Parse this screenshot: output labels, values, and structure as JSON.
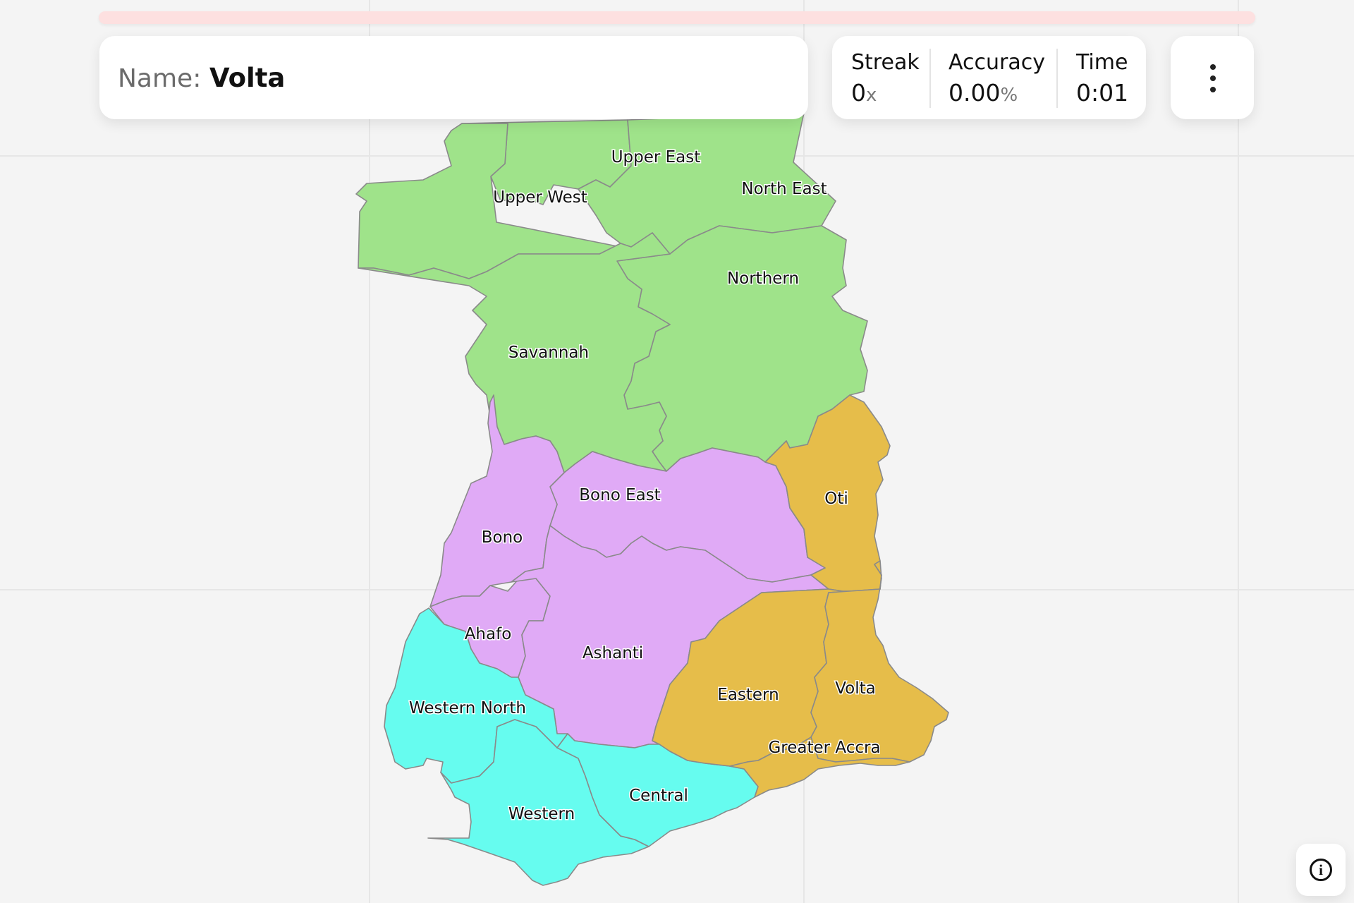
{
  "progress": {
    "fraction": 0.0
  },
  "prompt": {
    "label": "Name:",
    "value": "Volta"
  },
  "stats": [
    {
      "label": "Streak",
      "value": "0",
      "unit": "x"
    },
    {
      "label": "Accuracy",
      "value": "0.00",
      "unit": "%"
    },
    {
      "label": "Time",
      "value": "0:01",
      "unit": ""
    }
  ],
  "menu": {
    "icon": "more-vertical-icon"
  },
  "info": {
    "icon": "info-icon",
    "glyph": "i"
  },
  "map": {
    "colors": {
      "north": "#9fe38a",
      "middle": "#e0aaf6",
      "southwest": "#66fcef",
      "southeast": "#e6bd4a"
    },
    "regions": [
      {
        "name": "Upper East"
      },
      {
        "name": "Upper West"
      },
      {
        "name": "North East"
      },
      {
        "name": "Northern"
      },
      {
        "name": "Savannah"
      },
      {
        "name": "Bono East"
      },
      {
        "name": "Oti"
      },
      {
        "name": "Bono"
      },
      {
        "name": "Ahafo"
      },
      {
        "name": "Ashanti"
      },
      {
        "name": "Western North"
      },
      {
        "name": "Eastern"
      },
      {
        "name": "Volta"
      },
      {
        "name": "Greater Accra"
      },
      {
        "name": "Central"
      },
      {
        "name": "Western"
      }
    ]
  }
}
